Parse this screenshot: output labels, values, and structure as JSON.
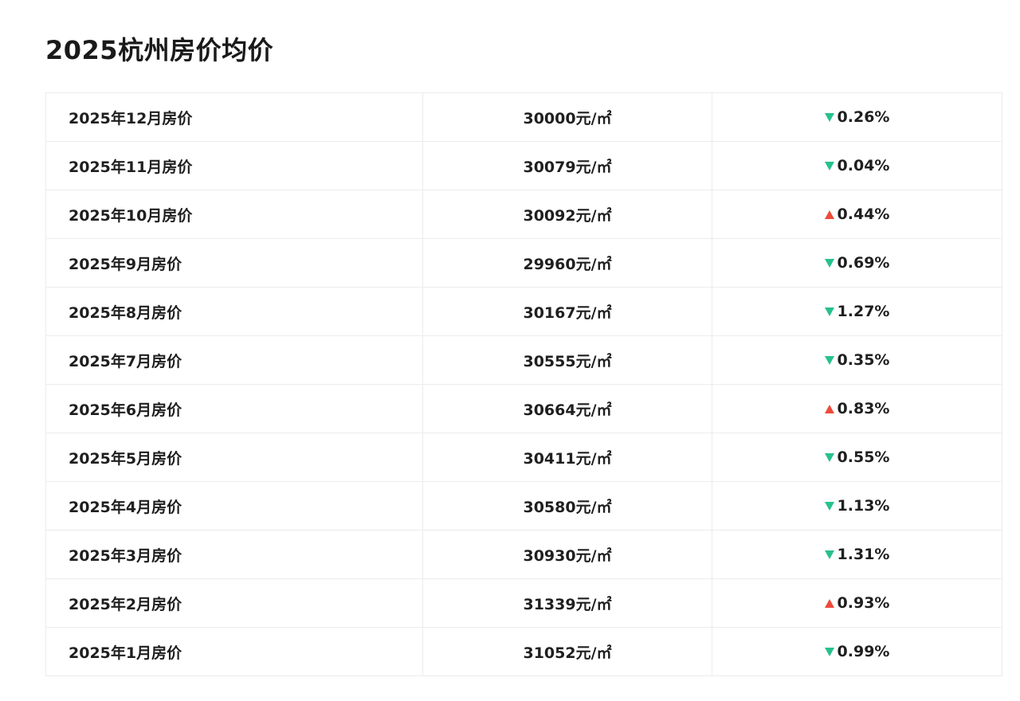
{
  "page": {
    "title": "2025杭州房价均价"
  },
  "colors": {
    "down_arrow": "#27c18e",
    "up_arrow": "#ee4b3a"
  },
  "rows": [
    {
      "month": "2025年12月房价",
      "price": "30000元/㎡",
      "direction": "down",
      "change": "0.26%"
    },
    {
      "month": "2025年11月房价",
      "price": "30079元/㎡",
      "direction": "down",
      "change": "0.04%"
    },
    {
      "month": "2025年10月房价",
      "price": "30092元/㎡",
      "direction": "up",
      "change": "0.44%"
    },
    {
      "month": "2025年9月房价",
      "price": "29960元/㎡",
      "direction": "down",
      "change": "0.69%"
    },
    {
      "month": "2025年8月房价",
      "price": "30167元/㎡",
      "direction": "down",
      "change": "1.27%"
    },
    {
      "month": "2025年7月房价",
      "price": "30555元/㎡",
      "direction": "down",
      "change": "0.35%"
    },
    {
      "month": "2025年6月房价",
      "price": "30664元/㎡",
      "direction": "up",
      "change": "0.83%"
    },
    {
      "month": "2025年5月房价",
      "price": "30411元/㎡",
      "direction": "down",
      "change": "0.55%"
    },
    {
      "month": "2025年4月房价",
      "price": "30580元/㎡",
      "direction": "down",
      "change": "1.13%"
    },
    {
      "month": "2025年3月房价",
      "price": "30930元/㎡",
      "direction": "down",
      "change": "1.31%"
    },
    {
      "month": "2025年2月房价",
      "price": "31339元/㎡",
      "direction": "up",
      "change": "0.93%"
    },
    {
      "month": "2025年1月房价",
      "price": "31052元/㎡",
      "direction": "down",
      "change": "0.99%"
    }
  ]
}
